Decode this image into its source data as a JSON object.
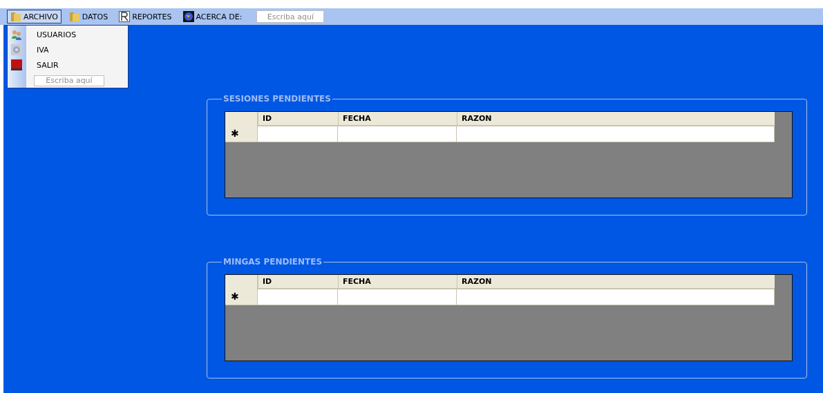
{
  "menu_bar": {
    "items": [
      {
        "label": "ARCHIVO",
        "kind": "folder",
        "selected": true
      },
      {
        "label": "DATOS",
        "kind": "folder",
        "selected": false
      },
      {
        "label": "REPORTES",
        "kind": "letter",
        "selected": false
      },
      {
        "label": "ACERCA DE:",
        "kind": "globe",
        "selected": false
      }
    ],
    "new_item_placeholder": "Escriba aquí"
  },
  "dropdown": {
    "items": [
      {
        "label": "USUARIOS",
        "kind": "users"
      },
      {
        "label": "IVA",
        "kind": "disc"
      },
      {
        "label": "SALIR",
        "kind": "exit"
      }
    ],
    "new_item_placeholder": "Escriba aquí"
  },
  "groups": [
    {
      "title": "SESIONES PENDIENTES",
      "columns": [
        "ID",
        "FECHA",
        "RAZON"
      ],
      "new_row_marker": "✱"
    },
    {
      "title": "MINGAS PENDIENTES",
      "columns": [
        "ID",
        "FECHA",
        "RAZON"
      ],
      "new_row_marker": "✱"
    }
  ]
}
